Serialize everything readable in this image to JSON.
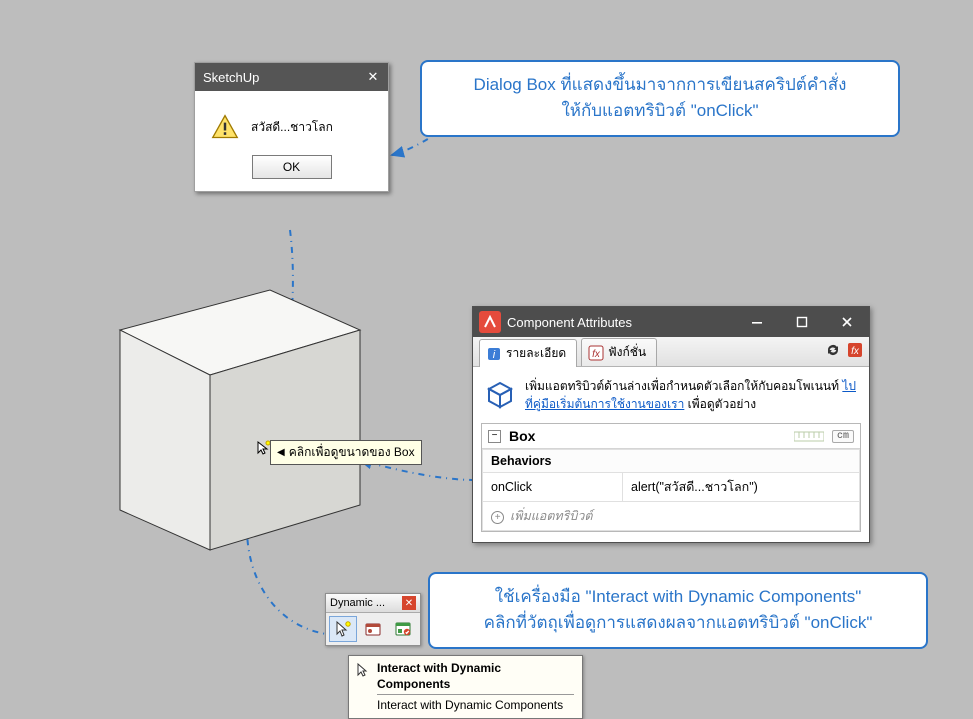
{
  "dialog": {
    "title": "SketchUp",
    "message": "สวัสดี...ชาวโลก",
    "ok": "OK"
  },
  "callouts": {
    "top_line1": "Dialog Box ที่แสดงขึ้นมาจากการเขียนสคริปต์คำสั่ง",
    "top_line2": "ให้กับแอตทริบิวต์ \"onClick\"",
    "bot_line1": "ใช้เครื่องมือ \"Interact with Dynamic Components\"",
    "bot_line2": "คลิกที่วัตถุเพื่อดูการแสดงผลจากแอตทริบิวต์ \"onClick\""
  },
  "cube_tooltip": "คลิกเพื่อดูขนาดของ Box",
  "attr": {
    "title": "Component Attributes",
    "tab_details": "รายละเอียด",
    "tab_functions": "ฟังก์ชั่น",
    "desc_prefix": "เพิ่มแอตทริบิวต์ด้านล่างเพื่อกำหนดตัวเลือกให้กับคอมโพเนนท์ ",
    "desc_link": "ไปที่คู่มือเริ่มต้นการใช้งานของเรา",
    "desc_suffix": " เพื่อดูตัวอย่าง",
    "component_name": "Box",
    "unit": "cm",
    "section": "Behaviors",
    "attr_name": "onClick",
    "attr_value": "alert(\"สวัสดี...ชาวโลก\")",
    "add_attr": "เพิ่มแอตทริบิวต์"
  },
  "dyn": {
    "title": "Dynamic ...",
    "tip_title": "Interact with Dynamic Components",
    "tip_sub": "Interact with Dynamic Components"
  }
}
